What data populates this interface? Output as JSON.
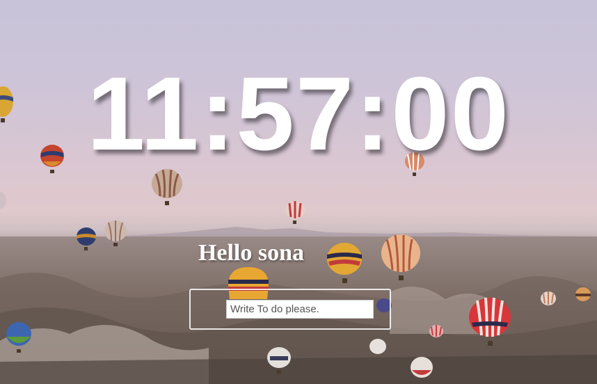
{
  "clock": {
    "time": "11:57:00"
  },
  "greeting": {
    "text": "Hello sona"
  },
  "todo": {
    "placeholder": "Write To do please.",
    "value": ""
  },
  "background": {
    "icon": "hot-air-balloons-landscape-photo"
  }
}
